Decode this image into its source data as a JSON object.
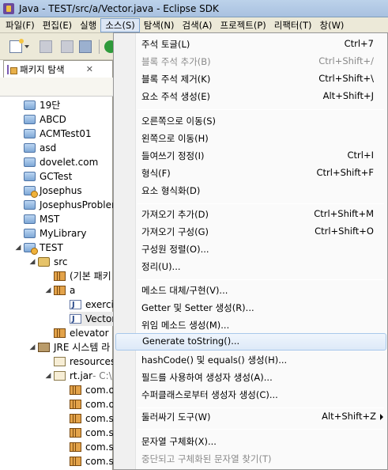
{
  "window": {
    "title": "Java - TEST/src/a/Vector.java - Eclipse SDK"
  },
  "menubar": [
    {
      "label": "파일(F)"
    },
    {
      "label": "편집(E)"
    },
    {
      "label": "실행"
    },
    {
      "label": "소스(S)"
    },
    {
      "label": "탐색(N)"
    },
    {
      "label": "검색(A)"
    },
    {
      "label": "프로젝트(P)"
    },
    {
      "label": "리팩터(T)"
    },
    {
      "label": "창(W)"
    }
  ],
  "explorer": {
    "tab_label": "패키지 탐색",
    "close_glyph": "✕",
    "items": [
      {
        "label": "19단"
      },
      {
        "label": "ABCD"
      },
      {
        "label": "ACMTest01"
      },
      {
        "label": "asd"
      },
      {
        "label": "dovelet.com"
      },
      {
        "label": "GCTest"
      },
      {
        "label": "Josephus"
      },
      {
        "label": "JosephusProblem"
      },
      {
        "label": "MST"
      },
      {
        "label": "MyLibrary"
      },
      {
        "label": "TEST"
      },
      {
        "label": "src"
      },
      {
        "label": "(기본 패키"
      },
      {
        "label": "a"
      },
      {
        "label": "exercis"
      },
      {
        "label": "Vector"
      },
      {
        "label": "elevator"
      },
      {
        "label": "JRE 시스템 라"
      },
      {
        "label": "resources._"
      },
      {
        "label": "rt.jar",
        "suffix": " - C:\\"
      },
      {
        "label": "com.o"
      },
      {
        "label": "com.o"
      },
      {
        "label": "com.su"
      },
      {
        "label": "com.su"
      },
      {
        "label": "com.su"
      },
      {
        "label": "com.su"
      }
    ]
  },
  "source_menu": {
    "items": [
      {
        "label": "주석 토글(L)",
        "shortcut": "Ctrl+7"
      },
      {
        "label": "블록 주석 추가(B)",
        "shortcut": "Ctrl+Shift+/"
      },
      {
        "label": "블록 주석 제거(K)",
        "shortcut": "Ctrl+Shift+\\"
      },
      {
        "label": "요소 주석 생성(E)",
        "shortcut": "Alt+Shift+J"
      },
      {
        "label": "오른쪽으로 이동(S)",
        "shortcut": ""
      },
      {
        "label": "왼쪽으로 이동(H)",
        "shortcut": ""
      },
      {
        "label": "들여쓰기 정정(I)",
        "shortcut": "Ctrl+I"
      },
      {
        "label": "형식(F)",
        "shortcut": "Ctrl+Shift+F"
      },
      {
        "label": "요소 형식화(D)",
        "shortcut": ""
      },
      {
        "label": "가져오기 추가(D)",
        "shortcut": "Ctrl+Shift+M"
      },
      {
        "label": "가져오기 구성(G)",
        "shortcut": "Ctrl+Shift+O"
      },
      {
        "label": "구성원 정렬(O)...",
        "shortcut": ""
      },
      {
        "label": "정리(U)...",
        "shortcut": ""
      },
      {
        "label": "메소드 대체/구현(V)...",
        "shortcut": ""
      },
      {
        "label": "Getter 및 Setter 생성(R)...",
        "shortcut": ""
      },
      {
        "label": "위임 메소드 생성(M)...",
        "shortcut": ""
      },
      {
        "label": "Generate toString()...",
        "shortcut": ""
      },
      {
        "label": "hashCode() 및 equals() 생성(H)...",
        "shortcut": ""
      },
      {
        "label": "필드를 사용하여 생성자 생성(A)...",
        "shortcut": ""
      },
      {
        "label": "수퍼클래스로부터 생성자 생성(C)...",
        "shortcut": ""
      },
      {
        "label": "둘러싸기 도구(W)",
        "shortcut": "Alt+Shift+Z"
      },
      {
        "label": "문자열 구체화(X)...",
        "shortcut": ""
      },
      {
        "label": "중단되고 구체화된 문자열 찾기(T)",
        "shortcut": ""
      }
    ]
  }
}
